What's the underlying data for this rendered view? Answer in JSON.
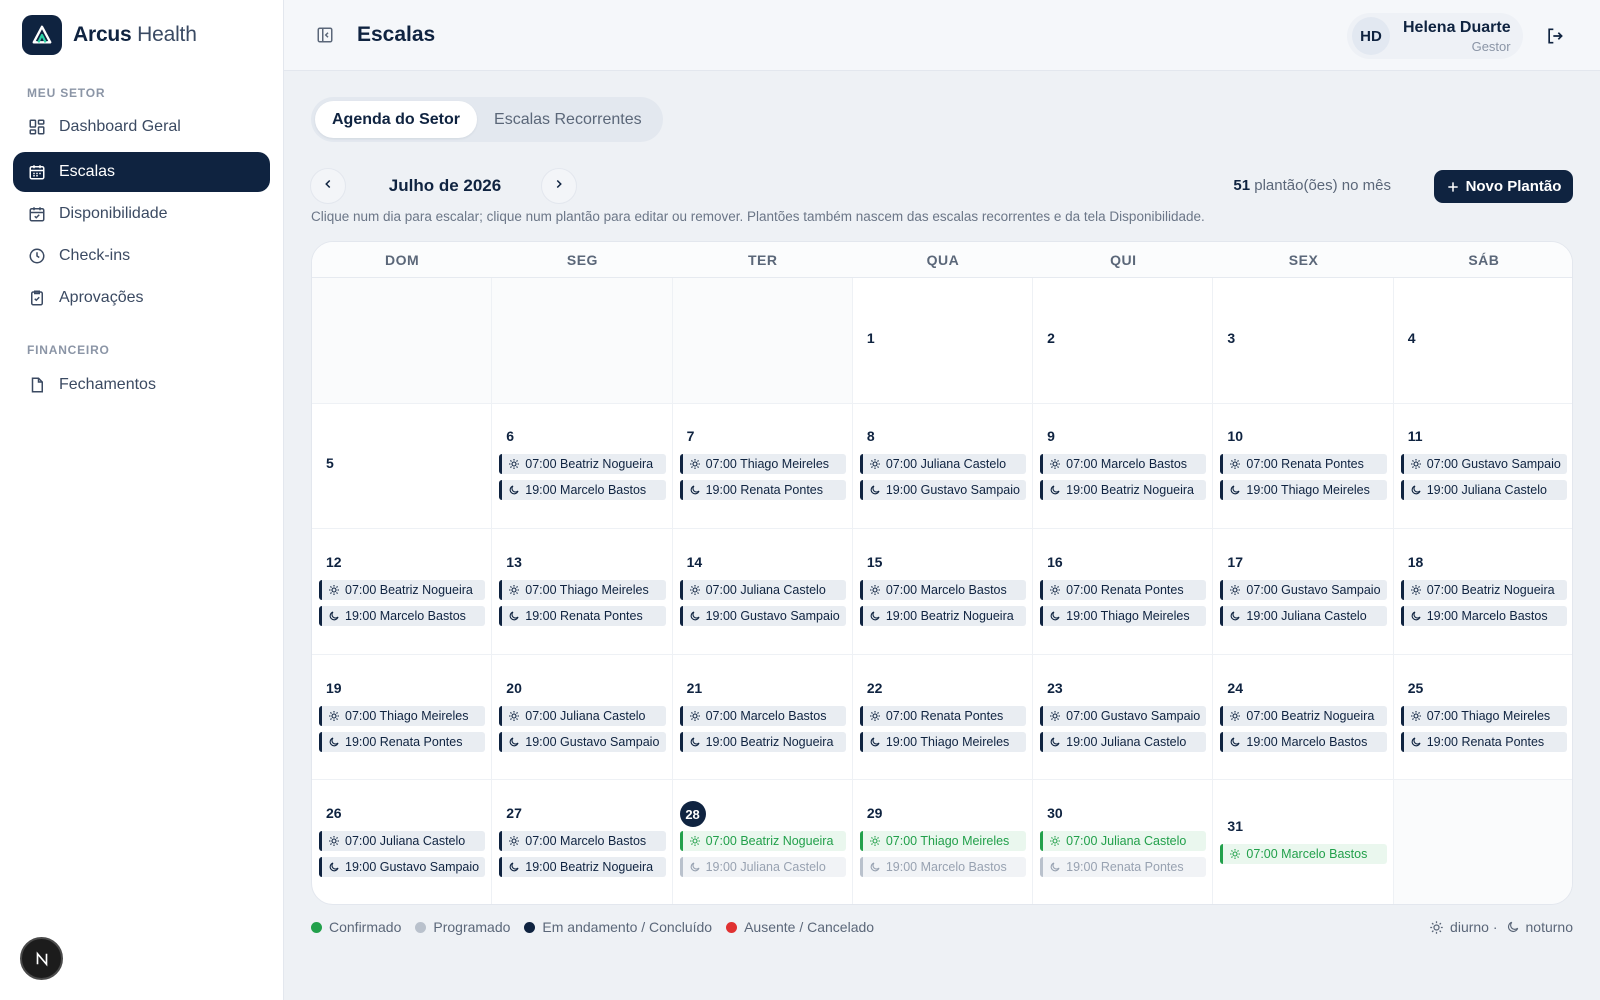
{
  "brand": {
    "name_bold": "Arcus",
    "name_light": "Health"
  },
  "sidebar": {
    "sections": [
      {
        "title": "MEU SETOR",
        "items": [
          {
            "label": "Dashboard Geral",
            "icon": "dashboard-icon"
          },
          {
            "label": "Escalas",
            "icon": "calendar-icon",
            "active": true
          },
          {
            "label": "Disponibilidade",
            "icon": "calendar-check-icon"
          },
          {
            "label": "Check-ins",
            "icon": "clock-icon"
          },
          {
            "label": "Aprovações",
            "icon": "clipboard-check-icon"
          }
        ]
      },
      {
        "title": "FINANCEIRO",
        "items": [
          {
            "label": "Fechamentos",
            "icon": "document-icon"
          }
        ]
      }
    ],
    "badge": "N"
  },
  "header": {
    "title": "Escalas",
    "user": {
      "initials": "HD",
      "name": "Helena Duarte",
      "role": "Gestor"
    }
  },
  "tabs": [
    {
      "label": "Agenda do Setor",
      "active": true
    },
    {
      "label": "Escalas Recorrentes",
      "active": false
    }
  ],
  "month_nav": {
    "month": "Julho de 2026",
    "count_number": "51",
    "count_text": "plantão(ões) no mês",
    "new_button": "Novo Plantão",
    "hint": "Clique num dia para escalar; clique num plantão para editar ou remover. Plantões também nascem das escalas recorrentes e da tela Disponibilidade."
  },
  "calendar": {
    "weekdays": [
      "DOM",
      "SEG",
      "TER",
      "QUA",
      "QUI",
      "SEX",
      "SÁB"
    ],
    "today": 28,
    "weeks": [
      [
        null,
        null,
        null,
        {
          "day": "1",
          "shifts": []
        },
        {
          "day": "2",
          "shifts": []
        },
        {
          "day": "3",
          "shifts": []
        },
        {
          "day": "4",
          "shifts": []
        }
      ],
      [
        {
          "day": "5",
          "shifts": []
        },
        {
          "day": "6",
          "shifts": [
            {
              "time": "07:00",
              "name": "Beatriz Nogueira",
              "kind": "day",
              "status": "done"
            },
            {
              "time": "19:00",
              "name": "Marcelo Bastos",
              "kind": "night",
              "status": "done"
            }
          ]
        },
        {
          "day": "7",
          "shifts": [
            {
              "time": "07:00",
              "name": "Thiago Meireles",
              "kind": "day",
              "status": "done"
            },
            {
              "time": "19:00",
              "name": "Renata Pontes",
              "kind": "night",
              "status": "done"
            }
          ]
        },
        {
          "day": "8",
          "shifts": [
            {
              "time": "07:00",
              "name": "Juliana Castelo",
              "kind": "day",
              "status": "done"
            },
            {
              "time": "19:00",
              "name": "Gustavo Sampaio",
              "kind": "night",
              "status": "done"
            }
          ]
        },
        {
          "day": "9",
          "shifts": [
            {
              "time": "07:00",
              "name": "Marcelo Bastos",
              "kind": "day",
              "status": "done"
            },
            {
              "time": "19:00",
              "name": "Beatriz Nogueira",
              "kind": "night",
              "status": "done"
            }
          ]
        },
        {
          "day": "10",
          "shifts": [
            {
              "time": "07:00",
              "name": "Renata Pontes",
              "kind": "day",
              "status": "done"
            },
            {
              "time": "19:00",
              "name": "Thiago Meireles",
              "kind": "night",
              "status": "done"
            }
          ]
        },
        {
          "day": "11",
          "shifts": [
            {
              "time": "07:00",
              "name": "Gustavo Sampaio",
              "kind": "day",
              "status": "done"
            },
            {
              "time": "19:00",
              "name": "Juliana Castelo",
              "kind": "night",
              "status": "done"
            }
          ]
        }
      ],
      [
        {
          "day": "12",
          "shifts": [
            {
              "time": "07:00",
              "name": "Beatriz Nogueira",
              "kind": "day",
              "status": "done"
            },
            {
              "time": "19:00",
              "name": "Marcelo Bastos",
              "kind": "night",
              "status": "done"
            }
          ]
        },
        {
          "day": "13",
          "shifts": [
            {
              "time": "07:00",
              "name": "Thiago Meireles",
              "kind": "day",
              "status": "done"
            },
            {
              "time": "19:00",
              "name": "Renata Pontes",
              "kind": "night",
              "status": "done"
            }
          ]
        },
        {
          "day": "14",
          "shifts": [
            {
              "time": "07:00",
              "name": "Juliana Castelo",
              "kind": "day",
              "status": "done"
            },
            {
              "time": "19:00",
              "name": "Gustavo Sampaio",
              "kind": "night",
              "status": "done"
            }
          ]
        },
        {
          "day": "15",
          "shifts": [
            {
              "time": "07:00",
              "name": "Marcelo Bastos",
              "kind": "day",
              "status": "done"
            },
            {
              "time": "19:00",
              "name": "Beatriz Nogueira",
              "kind": "night",
              "status": "done"
            }
          ]
        },
        {
          "day": "16",
          "shifts": [
            {
              "time": "07:00",
              "name": "Renata Pontes",
              "kind": "day",
              "status": "done"
            },
            {
              "time": "19:00",
              "name": "Thiago Meireles",
              "kind": "night",
              "status": "done"
            }
          ]
        },
        {
          "day": "17",
          "shifts": [
            {
              "time": "07:00",
              "name": "Gustavo Sampaio",
              "kind": "day",
              "status": "done"
            },
            {
              "time": "19:00",
              "name": "Juliana Castelo",
              "kind": "night",
              "status": "done"
            }
          ]
        },
        {
          "day": "18",
          "shifts": [
            {
              "time": "07:00",
              "name": "Beatriz Nogueira",
              "kind": "day",
              "status": "done"
            },
            {
              "time": "19:00",
              "name": "Marcelo Bastos",
              "kind": "night",
              "status": "done"
            }
          ]
        }
      ],
      [
        {
          "day": "19",
          "shifts": [
            {
              "time": "07:00",
              "name": "Thiago Meireles",
              "kind": "day",
              "status": "done"
            },
            {
              "time": "19:00",
              "name": "Renata Pontes",
              "kind": "night",
              "status": "done"
            }
          ]
        },
        {
          "day": "20",
          "shifts": [
            {
              "time": "07:00",
              "name": "Juliana Castelo",
              "kind": "day",
              "status": "done"
            },
            {
              "time": "19:00",
              "name": "Gustavo Sampaio",
              "kind": "night",
              "status": "done"
            }
          ]
        },
        {
          "day": "21",
          "shifts": [
            {
              "time": "07:00",
              "name": "Marcelo Bastos",
              "kind": "day",
              "status": "done"
            },
            {
              "time": "19:00",
              "name": "Beatriz Nogueira",
              "kind": "night",
              "status": "done"
            }
          ]
        },
        {
          "day": "22",
          "shifts": [
            {
              "time": "07:00",
              "name": "Renata Pontes",
              "kind": "day",
              "status": "done"
            },
            {
              "time": "19:00",
              "name": "Thiago Meireles",
              "kind": "night",
              "status": "done"
            }
          ]
        },
        {
          "day": "23",
          "shifts": [
            {
              "time": "07:00",
              "name": "Gustavo Sampaio",
              "kind": "day",
              "status": "done"
            },
            {
              "time": "19:00",
              "name": "Juliana Castelo",
              "kind": "night",
              "status": "done"
            }
          ]
        },
        {
          "day": "24",
          "shifts": [
            {
              "time": "07:00",
              "name": "Beatriz Nogueira",
              "kind": "day",
              "status": "done"
            },
            {
              "time": "19:00",
              "name": "Marcelo Bastos",
              "kind": "night",
              "status": "done"
            }
          ]
        },
        {
          "day": "25",
          "shifts": [
            {
              "time": "07:00",
              "name": "Thiago Meireles",
              "kind": "day",
              "status": "done"
            },
            {
              "time": "19:00",
              "name": "Renata Pontes",
              "kind": "night",
              "status": "done"
            }
          ]
        }
      ],
      [
        {
          "day": "26",
          "shifts": [
            {
              "time": "07:00",
              "name": "Juliana Castelo",
              "kind": "day",
              "status": "done"
            },
            {
              "time": "19:00",
              "name": "Gustavo Sampaio",
              "kind": "night",
              "status": "done"
            }
          ]
        },
        {
          "day": "27",
          "shifts": [
            {
              "time": "07:00",
              "name": "Marcelo Bastos",
              "kind": "day",
              "status": "done"
            },
            {
              "time": "19:00",
              "name": "Beatriz Nogueira",
              "kind": "night",
              "status": "done"
            }
          ]
        },
        {
          "day": "28",
          "shifts": [
            {
              "time": "07:00",
              "name": "Beatriz Nogueira",
              "kind": "day",
              "status": "confirmed"
            },
            {
              "time": "19:00",
              "name": "Juliana Castelo",
              "kind": "night",
              "status": "scheduled"
            }
          ]
        },
        {
          "day": "29",
          "shifts": [
            {
              "time": "07:00",
              "name": "Thiago Meireles",
              "kind": "day",
              "status": "confirmed"
            },
            {
              "time": "19:00",
              "name": "Marcelo Bastos",
              "kind": "night",
              "status": "scheduled"
            }
          ]
        },
        {
          "day": "30",
          "shifts": [
            {
              "time": "07:00",
              "name": "Juliana Castelo",
              "kind": "day",
              "status": "confirmed"
            },
            {
              "time": "19:00",
              "name": "Renata Pontes",
              "kind": "night",
              "status": "scheduled"
            }
          ]
        },
        {
          "day": "31",
          "shifts": [
            {
              "time": "07:00",
              "name": "Marcelo Bastos",
              "kind": "day",
              "status": "confirmed"
            }
          ]
        },
        null
      ]
    ]
  },
  "legend": {
    "items": [
      {
        "label": "Confirmado",
        "color": "#22a04b"
      },
      {
        "label": "Programado",
        "color": "#b9c1cc"
      },
      {
        "label": "Em andamento / Concluído",
        "color": "#0f2340"
      },
      {
        "label": "Ausente / Cancelado",
        "color": "#e03131"
      }
    ],
    "day_label": "diurno ·",
    "night_label": "noturno"
  }
}
